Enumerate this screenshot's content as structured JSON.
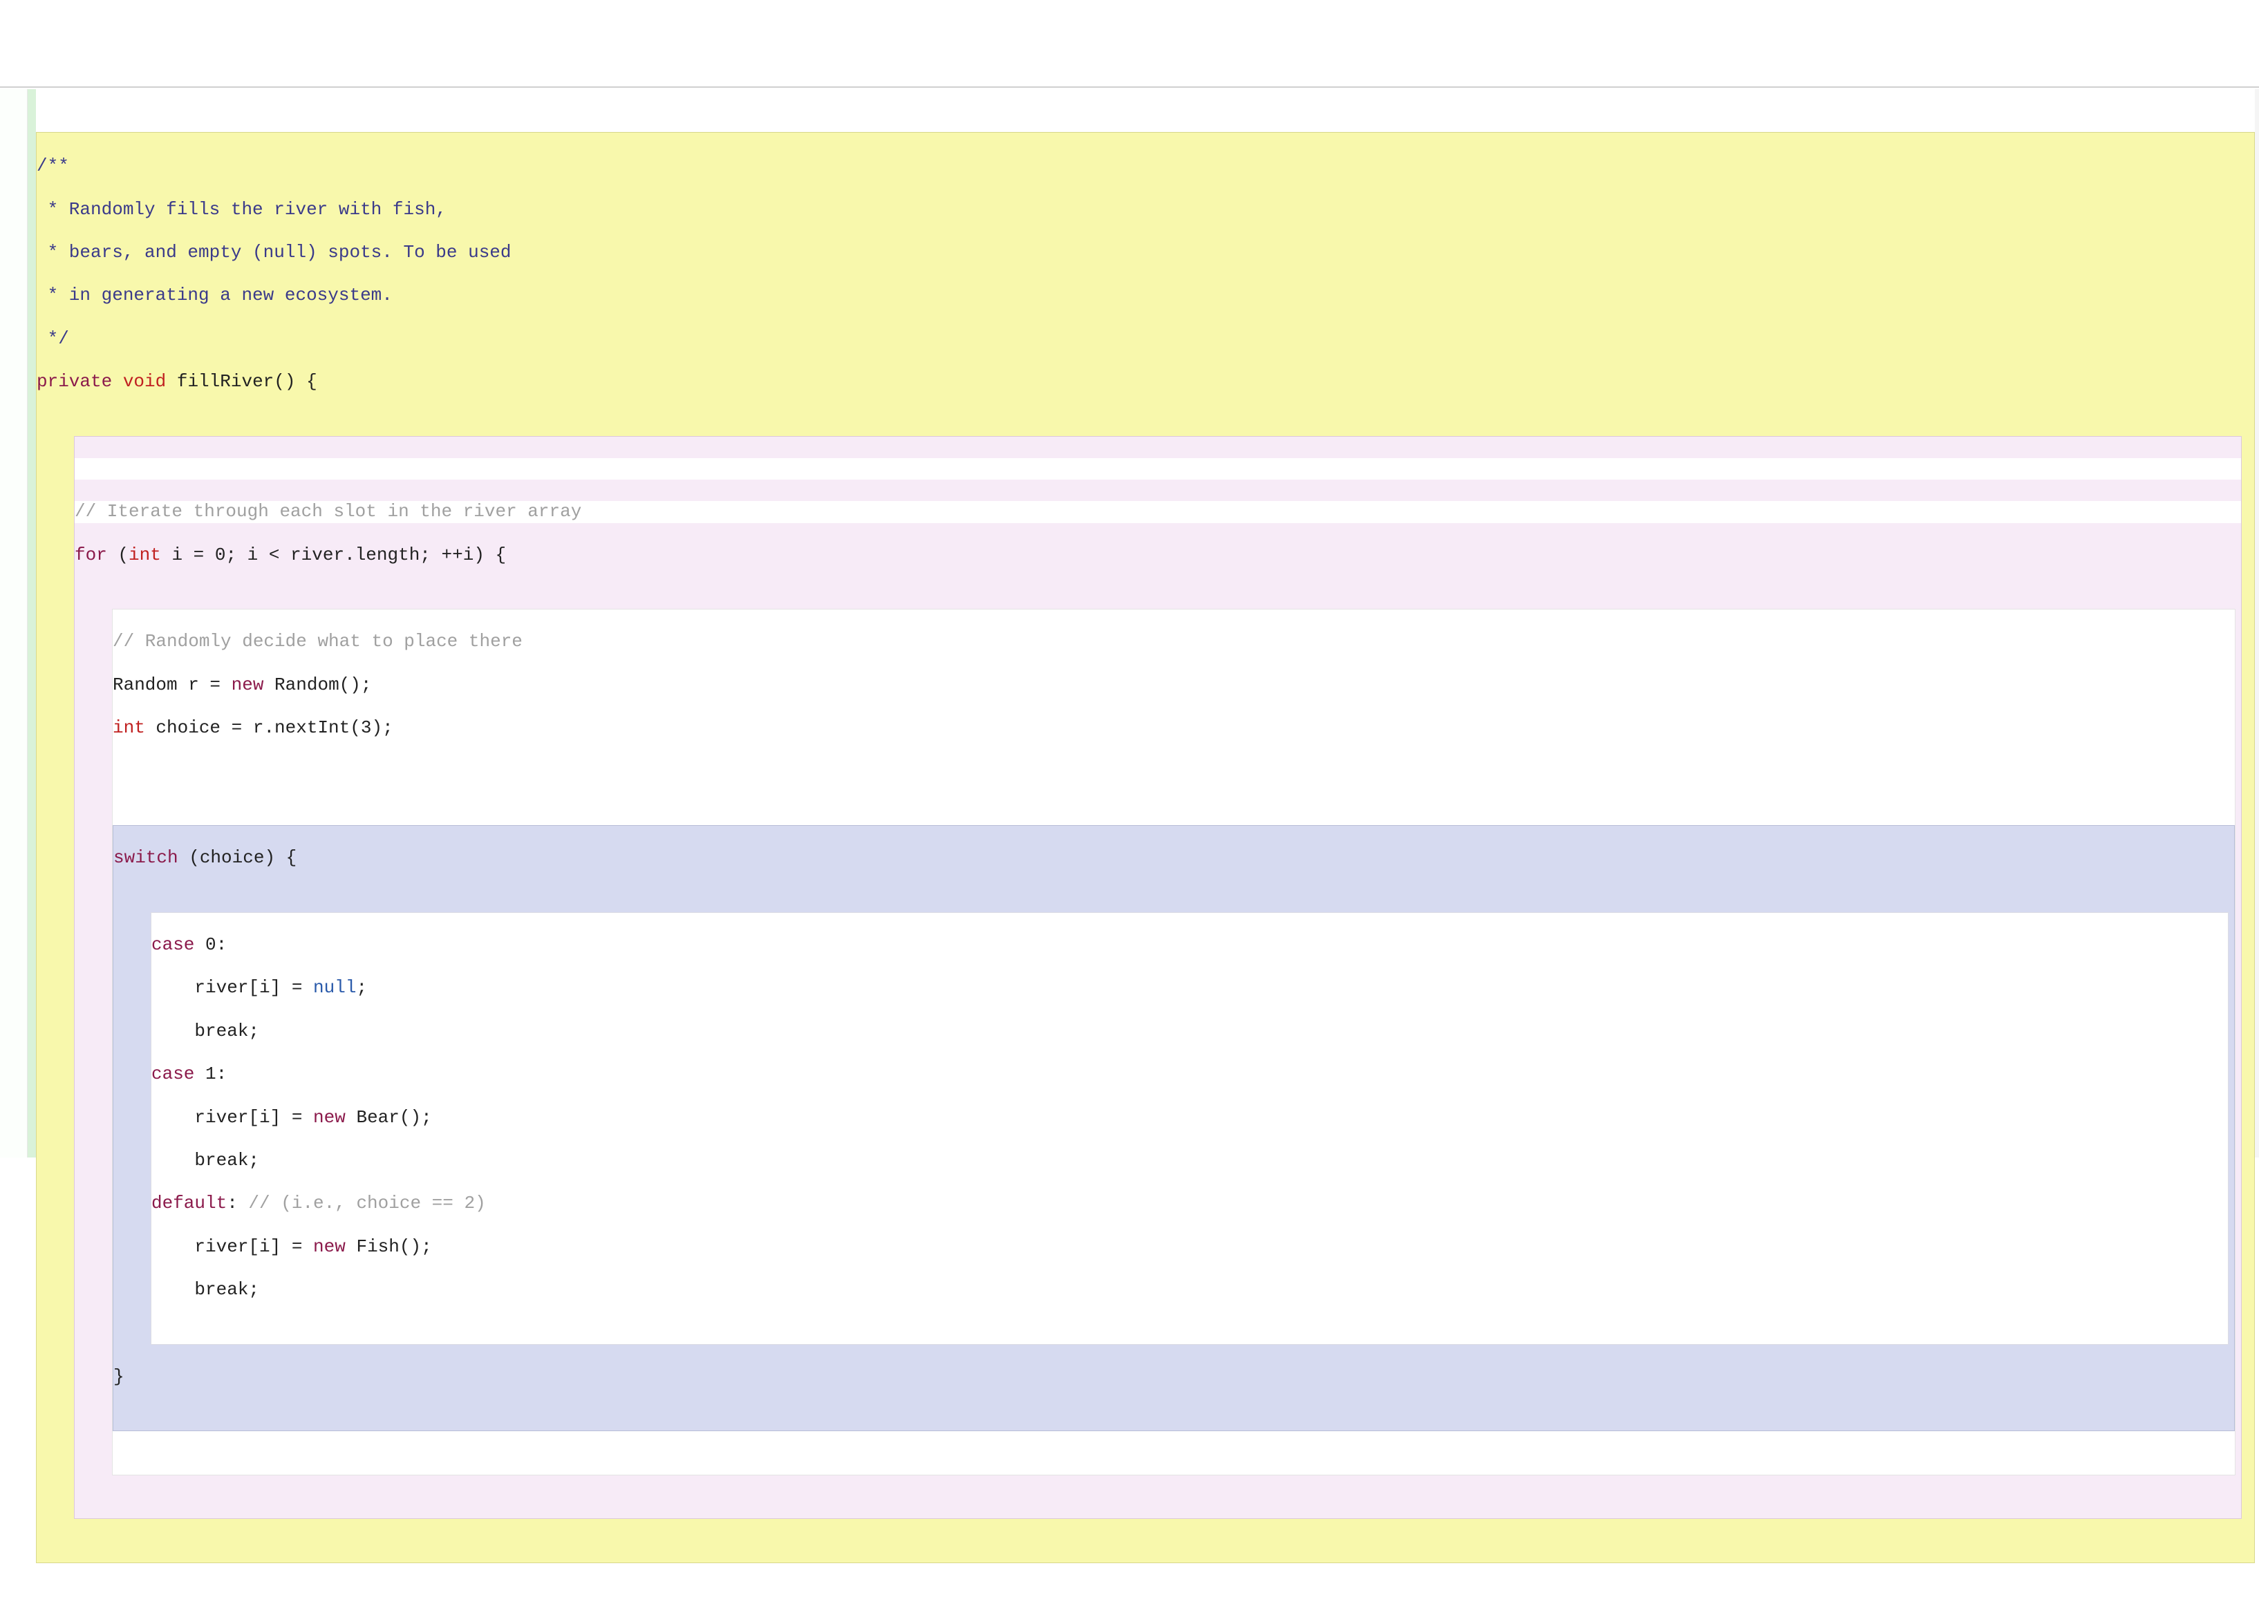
{
  "doc": {
    "l1": "/**",
    "l2": " * Randomly fills the river with fish,",
    "l3": " * bears, and empty (null) spots. To be used",
    "l4": " * in generating a new ecosystem.",
    "l5": " */"
  },
  "sig": {
    "private": "private",
    "void": "void",
    "name": " fillRiver() {"
  },
  "blank1": " ",
  "forblock": {
    "comment1": "// Iterate through each slot in the river array",
    "for": "for",
    "forparen": " (",
    "int1": "int",
    "forrest": " i = 0; i < river.length; ++i) {",
    "comment2": "// Randomly decide what to place there",
    "randline_a": "Random r = ",
    "new1": "new",
    "randline_b": " Random();",
    "int2": "int",
    "choiceline": " choice = r.nextInt(3);",
    "blank2": " ",
    "switch": "switch",
    "switchrest": " (choice) {",
    "case0_a": "case",
    "case0_b": " 0:",
    "case0_body": "    river[i] = ",
    "null": "null",
    "semi": ";",
    "break1": "    break;",
    "case1_a": "case",
    "case1_b": " 1:",
    "case1_body_a": "    river[i] = ",
    "new2": "new",
    "case1_body_b": " Bear();",
    "break2": "    break;",
    "default": "default",
    "default_colon": ":",
    "default_comment": " // (i.e., choice == 2)",
    "default_body_a": "    river[i] = ",
    "new3": "new",
    "default_body_b": " Fish();",
    "break3": "    break;",
    "switch_close": "}"
  }
}
